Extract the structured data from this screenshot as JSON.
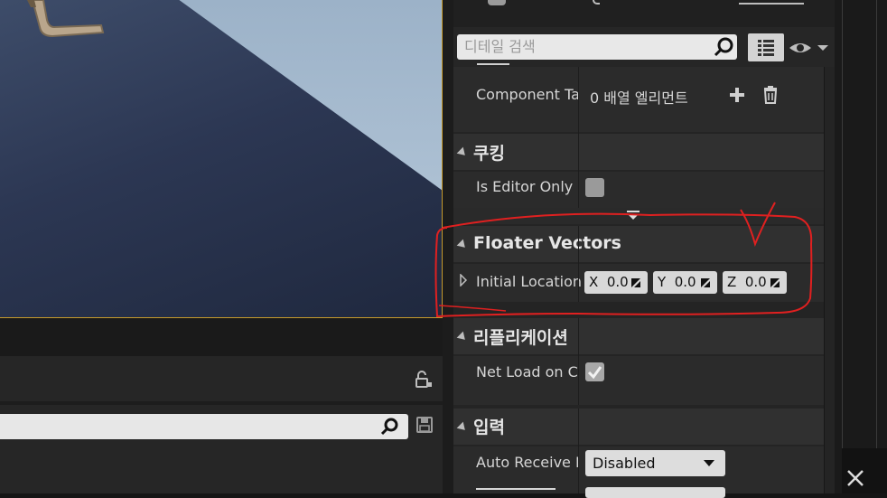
{
  "details": {
    "search_placeholder": "디테일 검색",
    "component_tags_label": "Component Tag",
    "component_tags_value": "0 배열 엘리먼트",
    "cooking_category": "쿠킹",
    "is_editor_only_label": "Is Editor Only",
    "is_editor_only_checked": false,
    "floater_category": "Floater Vectors",
    "initial_location_label": "Initial Location",
    "initial_location": {
      "x_axis": "X",
      "x": "0.0",
      "y_axis": "Y",
      "y": "0.0",
      "z_axis": "Z",
      "z": "0.0"
    },
    "replication_category": "리플리케이션",
    "net_load_label": "Net Load on Clie",
    "net_load_checked": true,
    "input_category": "입력",
    "auto_receive_label": "Auto Receive Inp",
    "auto_receive_value": "Disabled"
  },
  "colors": {
    "annotation": "#e02020",
    "viewport_border": "#c49a2c"
  }
}
